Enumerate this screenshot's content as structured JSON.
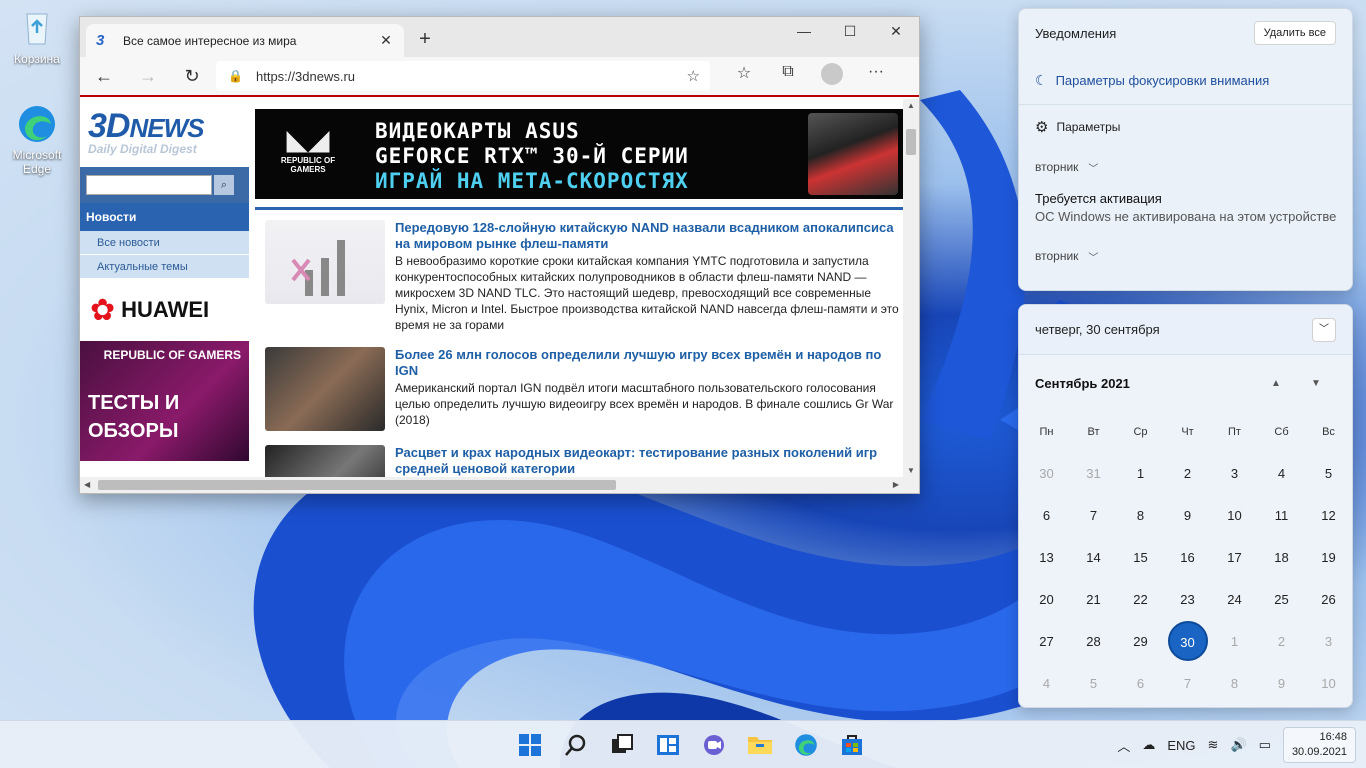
{
  "desktop": {
    "icons": [
      {
        "label": "Корзина",
        "icon": "recycle-bin-icon"
      },
      {
        "label": "Microsoft Edge",
        "icon": "edge-icon"
      }
    ]
  },
  "browser": {
    "tab_title": "Все самое интересное из мира",
    "url": "https://3dnews.ru",
    "site": {
      "logo_main": "3D",
      "logo_news": "NEWS",
      "logo_tagline": "Daily Digital Digest",
      "menu_head": "Новости",
      "menu_items": [
        "Все новости",
        "Актуальные темы"
      ],
      "huawei": "HUAWEI",
      "rog_brand": "REPUBLIC OF GAMERS",
      "rog_text": "ТЕСТЫ И ОБЗОРЫ",
      "banner": {
        "brand": "REPUBLIC OF GAMERS",
        "line1": "ВИДЕОКАРТЫ ASUS",
        "line2": "GEFORCE RTX™ 30-Й СЕРИИ",
        "line3": "ИГРАЙ НА МЕТА-СКОРОСТЯХ"
      },
      "news": [
        {
          "title": "Передовую 128-слойную китайскую NAND назвали всадником апокалипсиса на мировом рынке флеш-памяти",
          "body": "В невообразимо короткие сроки китайская компания YMTC подготовила и запустила конкурентоспособных китайских полупроводников в области флеш-памяти NAND — микросхем 3D NAND TLC. Это настоящий шедевр, превосходящий все современные Hynix, Micron и Intel. Быстрое производства китайской NAND навсегда флеш-памяти и это время не за горами"
        },
        {
          "title": "Более 26 млн голосов определили лучшую игру всех времён и народов по IGN",
          "body": "Американский портал IGN подвёл итоги масштабного пользовательского голосования целью определить лучшую видеоигру всех времён и народов. В финале сошлись Gr War (2018)"
        },
        {
          "title": "Расцвет и крах народных видеокарт: тестирование разных поколений игр средней ценовой категории",
          "body": ""
        }
      ]
    }
  },
  "notifications": {
    "title": "Уведомления",
    "clear_all": "Удалить все",
    "focus": "Параметры фокусировки внимания",
    "settings": "Параметры",
    "group1": "вторник",
    "activation_title": "Требуется активация",
    "activation_body": "ОС Windows не активирована на этом устройстве",
    "group2": "вторник"
  },
  "calendar": {
    "header": "четверг, 30 сентября",
    "month": "Сентябрь 2021",
    "weekdays": [
      "Пн",
      "Вт",
      "Ср",
      "Чт",
      "Пт",
      "Сб",
      "Вс"
    ],
    "days": [
      {
        "d": "30",
        "out": true
      },
      {
        "d": "31",
        "out": true
      },
      {
        "d": "1"
      },
      {
        "d": "2"
      },
      {
        "d": "3"
      },
      {
        "d": "4"
      },
      {
        "d": "5"
      },
      {
        "d": "6"
      },
      {
        "d": "7"
      },
      {
        "d": "8"
      },
      {
        "d": "9"
      },
      {
        "d": "10"
      },
      {
        "d": "11"
      },
      {
        "d": "12"
      },
      {
        "d": "13"
      },
      {
        "d": "14"
      },
      {
        "d": "15"
      },
      {
        "d": "16"
      },
      {
        "d": "17"
      },
      {
        "d": "18"
      },
      {
        "d": "19"
      },
      {
        "d": "20"
      },
      {
        "d": "21"
      },
      {
        "d": "22"
      },
      {
        "d": "23"
      },
      {
        "d": "24"
      },
      {
        "d": "25"
      },
      {
        "d": "26"
      },
      {
        "d": "27"
      },
      {
        "d": "28"
      },
      {
        "d": "29"
      },
      {
        "d": "30",
        "today": true
      },
      {
        "d": "1",
        "out": true
      },
      {
        "d": "2",
        "out": true
      },
      {
        "d": "3",
        "out": true
      },
      {
        "d": "4",
        "out": true
      },
      {
        "d": "5",
        "out": true
      },
      {
        "d": "6",
        "out": true
      },
      {
        "d": "7",
        "out": true
      },
      {
        "d": "8",
        "out": true
      },
      {
        "d": "9",
        "out": true
      },
      {
        "d": "10",
        "out": true
      }
    ]
  },
  "taskbar": {
    "lang": "ENG",
    "time": "16:48",
    "date": "30.09.2021"
  }
}
